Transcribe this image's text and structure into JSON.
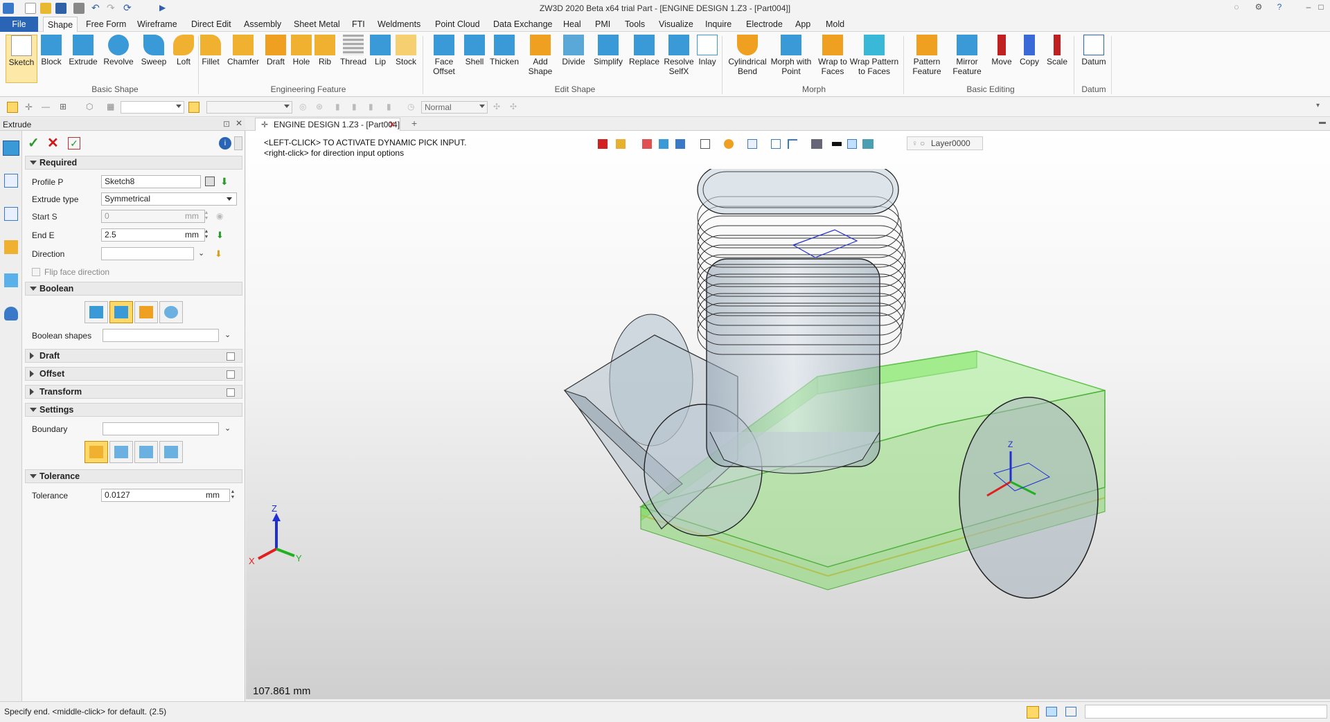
{
  "window": {
    "title": "ZW3D 2020 Beta x64 trial        Part - [ENGINE DESIGN 1.Z3 - [Part004]]"
  },
  "menu": {
    "file": "File",
    "tabs": [
      "Shape",
      "Free Form",
      "Wireframe",
      "Direct Edit",
      "Assembly",
      "Sheet Metal",
      "FTI",
      "Weldments",
      "Point Cloud",
      "Data Exchange",
      "Heal",
      "PMI",
      "Tools",
      "Visualize",
      "Inquire",
      "Electrode",
      "App",
      "Mold"
    ]
  },
  "ribbon": {
    "tools": [
      {
        "label": "Sketch",
        "icon": "sketch-icon"
      },
      {
        "label": "Block",
        "icon": "block-icon"
      },
      {
        "label": "Extrude",
        "icon": "extrude-icon"
      },
      {
        "label": "Revolve",
        "icon": "revolve-icon"
      },
      {
        "label": "Sweep",
        "icon": "sweep-icon"
      },
      {
        "label": "Loft",
        "icon": "loft-icon"
      },
      {
        "label": "Fillet",
        "icon": "fillet-icon"
      },
      {
        "label": "Chamfer",
        "icon": "chamfer-icon"
      },
      {
        "label": "Draft",
        "icon": "draft-icon"
      },
      {
        "label": "Hole",
        "icon": "hole-icon"
      },
      {
        "label": "Rib",
        "icon": "rib-icon"
      },
      {
        "label": "Thread",
        "icon": "thread-icon"
      },
      {
        "label": "Lip",
        "icon": "lip-icon"
      },
      {
        "label": "Stock",
        "icon": "stock-icon"
      },
      {
        "label": "Face\nOffset",
        "icon": "face-offset-icon"
      },
      {
        "label": "Shell",
        "icon": "shell-icon"
      },
      {
        "label": "Thicken",
        "icon": "thicken-icon"
      },
      {
        "label": "Add\nShape",
        "icon": "add-shape-icon"
      },
      {
        "label": "Divide",
        "icon": "divide-icon"
      },
      {
        "label": "Simplify",
        "icon": "simplify-icon"
      },
      {
        "label": "Replace",
        "icon": "replace-icon"
      },
      {
        "label": "Resolve\nSelfX",
        "icon": "resolve-selfx-icon"
      },
      {
        "label": "Inlay",
        "icon": "inlay-icon"
      },
      {
        "label": "Cylindrical\nBend",
        "icon": "cylindrical-bend-icon"
      },
      {
        "label": "Morph with\nPoint",
        "icon": "morph-point-icon"
      },
      {
        "label": "Wrap to\nFaces",
        "icon": "wrap-faces-icon"
      },
      {
        "label": "Wrap Pattern\nto Faces",
        "icon": "wrap-pattern-icon"
      },
      {
        "label": "Pattern\nFeature",
        "icon": "pattern-feature-icon"
      },
      {
        "label": "Mirror\nFeature",
        "icon": "mirror-feature-icon"
      },
      {
        "label": "Move",
        "icon": "move-icon"
      },
      {
        "label": "Copy",
        "icon": "copy-icon"
      },
      {
        "label": "Scale",
        "icon": "scale-icon"
      },
      {
        "label": "Datum",
        "icon": "datum-icon"
      }
    ],
    "groups": [
      "Basic Shape",
      "Engineering Feature",
      "Edit Shape",
      "Morph",
      "Basic Editing",
      "Datum"
    ]
  },
  "toolbar2": {
    "render_mode": "Normal"
  },
  "panel": {
    "title": "Extrude",
    "sections": {
      "required": "Required",
      "boolean": "Boolean",
      "draft": "Draft",
      "offset": "Offset",
      "transform": "Transform",
      "settings": "Settings",
      "tolerance": "Tolerance"
    },
    "fields": {
      "profile_label": "Profile P",
      "profile_value": "Sketch8",
      "type_label": "Extrude type",
      "type_value": "Symmetrical",
      "start_label": "Start S",
      "start_value": "0",
      "start_unit": "mm",
      "end_label": "End E",
      "end_value": "2.5",
      "end_unit": "mm",
      "direction_label": "Direction",
      "direction_value": "",
      "flip_label": "Flip face direction",
      "boolean_shapes_label": "Boolean shapes",
      "boundary_label": "Boundary",
      "tolerance_label": "Tolerance",
      "tolerance_value": "0.0127",
      "tolerance_unit": "mm"
    }
  },
  "viewport": {
    "doc_tab": "ENGINE DESIGN 1.Z3 - [Part004]",
    "hint1": "<LEFT-CLICK> TO ACTIVATE DYNAMIC PICK INPUT.",
    "hint2": "<right-click> for direction input options",
    "layer": "Layer0000",
    "scale": "107.861 mm",
    "axis": {
      "x": "X",
      "y": "Y",
      "z": "Z"
    }
  },
  "status": {
    "text": "Specify end.  <middle-click> for default. (2.5)"
  },
  "colors": {
    "accent": "#2a64b4",
    "highlight": "#ffd86a",
    "model_green": "#8fe07a",
    "axis_x": "#e02020",
    "axis_y": "#20b020",
    "axis_z": "#2030d0"
  }
}
